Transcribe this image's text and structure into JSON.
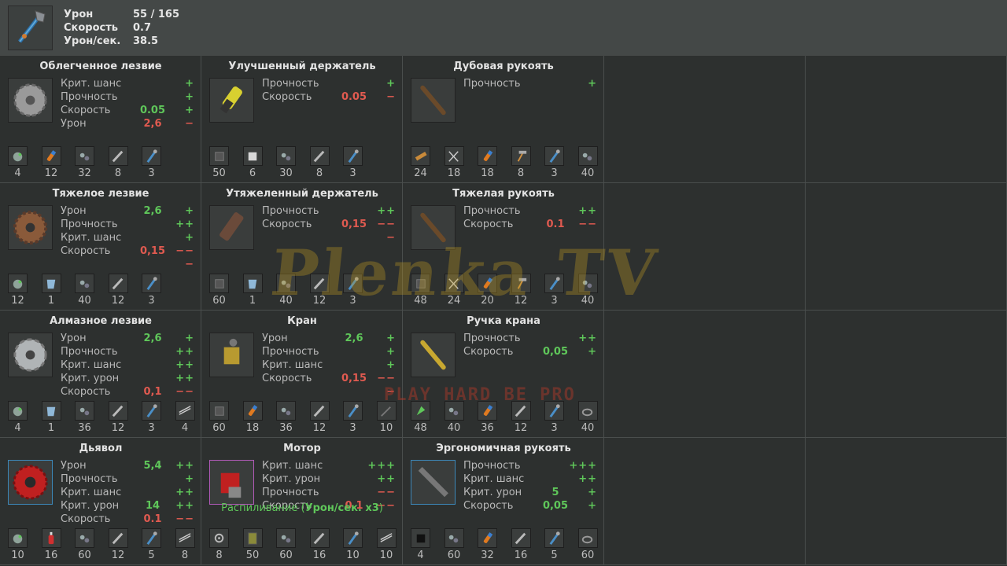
{
  "header": {
    "stats": [
      {
        "label": "Урон",
        "value": "55 / 165"
      },
      {
        "label": "Скорость",
        "value": "0.7"
      },
      {
        "label": "Урон/сек.",
        "value": "38.5"
      }
    ]
  },
  "cells": [
    {
      "title": "Облегченное лезвие",
      "icon": "blade-light-icon",
      "stats": [
        {
          "label": "Крит. шанс",
          "value": "",
          "mod": "+",
          "tone": "pos"
        },
        {
          "label": "Прочность",
          "value": "",
          "mod": "+",
          "tone": "pos"
        },
        {
          "label": "Скорость",
          "value": "0.05",
          "mod": "+",
          "tone": "pos"
        },
        {
          "label": "Урон",
          "value": "2,6",
          "mod": "−",
          "tone": "neg"
        }
      ],
      "mats": [
        {
          "icon": "scrap-icon",
          "count": "4"
        },
        {
          "icon": "fuse-icon",
          "count": "12"
        },
        {
          "icon": "bolt-icon",
          "count": "32"
        },
        {
          "icon": "wrench-icon",
          "count": "8"
        },
        {
          "icon": "staff-icon",
          "count": "3"
        }
      ]
    },
    {
      "title": "Улучшенный держатель",
      "icon": "holder-improved-icon",
      "stats": [
        {
          "label": "Прочность",
          "value": "",
          "mod": "+",
          "tone": "pos"
        },
        {
          "label": "Скорость",
          "value": "0.05",
          "mod": "−",
          "tone": "neg"
        }
      ],
      "mats": [
        {
          "icon": "metal-icon",
          "count": "50"
        },
        {
          "icon": "plate-icon",
          "count": "6"
        },
        {
          "icon": "bolt-icon",
          "count": "30"
        },
        {
          "icon": "wrench-icon",
          "count": "8"
        },
        {
          "icon": "staff-icon",
          "count": "3"
        }
      ]
    },
    {
      "title": "Дубовая рукоять",
      "icon": "oak-handle-icon",
      "stats": [
        {
          "label": "Прочность",
          "value": "",
          "mod": "+",
          "tone": "pos"
        }
      ],
      "mats": [
        {
          "icon": "wood-icon",
          "count": "24"
        },
        {
          "icon": "scissors-icon",
          "count": "18"
        },
        {
          "icon": "fuse-icon",
          "count": "18"
        },
        {
          "icon": "hammer-icon",
          "count": "8"
        },
        {
          "icon": "staff-icon",
          "count": "3"
        },
        {
          "icon": "bolt-icon",
          "count": "40"
        }
      ]
    },
    {
      "title": "Тяжелое лезвие",
      "icon": "blade-heavy-icon",
      "stats": [
        {
          "label": "Урон",
          "value": "2,6",
          "mod": "+",
          "tone": "pos"
        },
        {
          "label": "Прочность",
          "value": "",
          "mod": "++",
          "tone": "pos"
        },
        {
          "label": "Крит. шанс",
          "value": "",
          "mod": "+",
          "tone": "pos"
        },
        {
          "label": "Скорость",
          "value": "0,15",
          "mod": "−−−",
          "tone": "neg"
        }
      ],
      "mats": [
        {
          "icon": "scrap-icon",
          "count": "12"
        },
        {
          "icon": "glass-icon",
          "count": "1"
        },
        {
          "icon": "bolt-icon",
          "count": "40"
        },
        {
          "icon": "wrench-icon",
          "count": "12"
        },
        {
          "icon": "staff-icon",
          "count": "3"
        }
      ]
    },
    {
      "title": "Утяжеленный держатель",
      "icon": "holder-heavy-icon",
      "stats": [
        {
          "label": "Прочность",
          "value": "",
          "mod": "++",
          "tone": "pos"
        },
        {
          "label": "Скорость",
          "value": "0,15",
          "mod": "−−−",
          "tone": "neg"
        }
      ],
      "mats": [
        {
          "icon": "metal-icon",
          "count": "60"
        },
        {
          "icon": "glass-icon",
          "count": "1"
        },
        {
          "icon": "bolt-icon",
          "count": "40"
        },
        {
          "icon": "wrench-icon",
          "count": "12"
        },
        {
          "icon": "staff-icon",
          "count": "3"
        }
      ]
    },
    {
      "title": "Тяжелая рукоять",
      "icon": "handle-heavy-icon",
      "stats": [
        {
          "label": "Прочность",
          "value": "",
          "mod": "++",
          "tone": "pos"
        },
        {
          "label": "Скорость",
          "value": "0.1",
          "mod": "−−",
          "tone": "neg"
        }
      ],
      "mats": [
        {
          "icon": "metal-icon",
          "count": "48"
        },
        {
          "icon": "scissors-icon",
          "count": "24"
        },
        {
          "icon": "fuse-icon",
          "count": "20"
        },
        {
          "icon": "hammer-icon",
          "count": "12"
        },
        {
          "icon": "staff-icon",
          "count": "3"
        },
        {
          "icon": "bolt-icon",
          "count": "40"
        }
      ]
    },
    {
      "title": "Алмазное лезвие",
      "icon": "blade-diamond-icon",
      "stats": [
        {
          "label": "Урон",
          "value": "2,6",
          "mod": "+",
          "tone": "pos"
        },
        {
          "label": "Прочность",
          "value": "",
          "mod": "++",
          "tone": "pos"
        },
        {
          "label": "Крит. шанс",
          "value": "",
          "mod": "++",
          "tone": "pos"
        },
        {
          "label": "Крит. урон",
          "value": "",
          "mod": "++",
          "tone": "pos"
        },
        {
          "label": "Скорость",
          "value": "0,1",
          "mod": "−−",
          "tone": "neg"
        }
      ],
      "mats": [
        {
          "icon": "scrap-icon",
          "count": "4"
        },
        {
          "icon": "glass-icon",
          "count": "1"
        },
        {
          "icon": "bolt-icon",
          "count": "36"
        },
        {
          "icon": "wrench-icon",
          "count": "12"
        },
        {
          "icon": "staff-icon",
          "count": "3"
        },
        {
          "icon": "rods-icon",
          "count": "4"
        }
      ]
    },
    {
      "title": "Кран",
      "icon": "crane-icon",
      "stats": [
        {
          "label": "Урон",
          "value": "2,6",
          "mod": "+",
          "tone": "pos"
        },
        {
          "label": "Прочность",
          "value": "",
          "mod": "+",
          "tone": "pos"
        },
        {
          "label": "Крит. шанс",
          "value": "",
          "mod": "+",
          "tone": "pos"
        },
        {
          "label": "Скорость",
          "value": "0,15",
          "mod": "−−−",
          "tone": "neg"
        }
      ],
      "mats": [
        {
          "icon": "metal-icon",
          "count": "60"
        },
        {
          "icon": "fuse-icon",
          "count": "18"
        },
        {
          "icon": "bolt-icon",
          "count": "36"
        },
        {
          "icon": "wrench-icon",
          "count": "12"
        },
        {
          "icon": "staff-icon",
          "count": "3"
        },
        {
          "icon": "rod-icon",
          "count": "10"
        }
      ]
    },
    {
      "title": "Ручка крана",
      "icon": "crane-handle-icon",
      "stats": [
        {
          "label": "Прочность",
          "value": "",
          "mod": "++",
          "tone": "pos"
        },
        {
          "label": "Скорость",
          "value": "0,05",
          "mod": "+",
          "tone": "pos"
        }
      ],
      "mats": [
        {
          "icon": "herb-icon",
          "count": "48"
        },
        {
          "icon": "bolt-icon",
          "count": "40"
        },
        {
          "icon": "fuse-icon",
          "count": "36"
        },
        {
          "icon": "wrench-icon",
          "count": "12"
        },
        {
          "icon": "staff-icon",
          "count": "3"
        },
        {
          "icon": "ring-icon",
          "count": "40"
        }
      ]
    },
    {
      "title": "Дьявол",
      "icon": "devil-blade-icon",
      "border": "blue",
      "stats": [
        {
          "label": "Урон",
          "value": "5,4",
          "mod": "++",
          "tone": "pos"
        },
        {
          "label": "Прочность",
          "value": "",
          "mod": "+",
          "tone": "pos"
        },
        {
          "label": "Крит. шанс",
          "value": "",
          "mod": "++",
          "tone": "pos"
        },
        {
          "label": "Крит. урон",
          "value": "14",
          "mod": "++",
          "tone": "pos"
        },
        {
          "label": "Скорость",
          "value": "0.1",
          "mod": "−−",
          "tone": "neg"
        }
      ],
      "mats": [
        {
          "icon": "scrap-icon",
          "count": "10"
        },
        {
          "icon": "extinguisher-icon",
          "count": "16"
        },
        {
          "icon": "bolt-icon",
          "count": "60"
        },
        {
          "icon": "wrench-icon",
          "count": "12"
        },
        {
          "icon": "staff-icon",
          "count": "5"
        },
        {
          "icon": "rods-icon",
          "count": "8"
        }
      ]
    },
    {
      "title": "Мотор",
      "icon": "motor-icon",
      "border": "purple",
      "stats": [
        {
          "label": "Крит. шанс",
          "value": "",
          "mod": "+++",
          "tone": "pos"
        },
        {
          "label": "Крит. урон",
          "value": "",
          "mod": "++",
          "tone": "pos"
        },
        {
          "label": "Прочность",
          "value": "",
          "mod": "−−",
          "tone": "neg"
        },
        {
          "label": "Скорость",
          "value": "0.1",
          "mod": "−−",
          "tone": "neg"
        }
      ],
      "special": {
        "prefix": "Распиливание (",
        "bold": "Урон/сек. x3",
        "suffix": ")"
      },
      "mats": [
        {
          "icon": "gear-icon",
          "count": "8"
        },
        {
          "icon": "book-icon",
          "count": "50"
        },
        {
          "icon": "bolt-icon",
          "count": "60"
        },
        {
          "icon": "wrench-icon",
          "count": "16"
        },
        {
          "icon": "staff-icon",
          "count": "10"
        },
        {
          "icon": "rods-icon",
          "count": "10"
        }
      ]
    },
    {
      "title": "Эргономичная рукоять",
      "icon": "ergo-handle-icon",
      "border": "blue",
      "stats": [
        {
          "label": "Прочность",
          "value": "",
          "mod": "+++",
          "tone": "pos"
        },
        {
          "label": "Крит. шанс",
          "value": "",
          "mod": "++",
          "tone": "pos"
        },
        {
          "label": "Крит. урон",
          "value": "5",
          "mod": "+",
          "tone": "pos"
        },
        {
          "label": "Скорость",
          "value": "0,05",
          "mod": "+",
          "tone": "pos"
        }
      ],
      "mats": [
        {
          "icon": "tape-icon",
          "count": "4"
        },
        {
          "icon": "bolt-icon",
          "count": "60"
        },
        {
          "icon": "fuse-icon",
          "count": "32"
        },
        {
          "icon": "wrench-icon",
          "count": "16"
        },
        {
          "icon": "staff-icon",
          "count": "5"
        },
        {
          "icon": "ring-icon",
          "count": "60"
        }
      ]
    }
  ],
  "watermark": {
    "main": "Plenka TV",
    "sub": "PLAY HARD BE PRO"
  },
  "colors": {
    "positive": "#5fc75a",
    "negative": "#e05a50",
    "rare_border": "#3c87b8",
    "epic_border": "#b15ab8"
  }
}
